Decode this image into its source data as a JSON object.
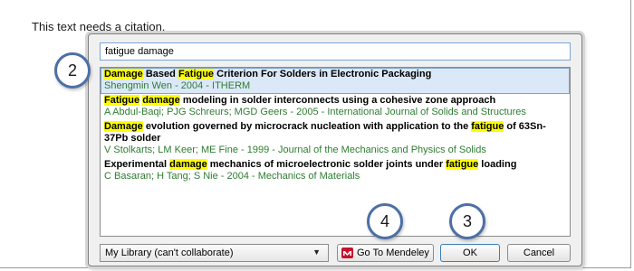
{
  "document": {
    "text": "This text needs a citation."
  },
  "dialog": {
    "search": {
      "value": "fatigue damage"
    },
    "results": [
      {
        "title_parts": [
          {
            "text": "Damage",
            "hl": true
          },
          {
            "text": " Based ",
            "hl": false
          },
          {
            "text": "Fatigue",
            "hl": true
          },
          {
            "text": " Criterion For Solders in Electronic Packaging",
            "hl": false
          }
        ],
        "meta": "Shengmin Wen - 2004 - ITHERM",
        "selected": true
      },
      {
        "title_parts": [
          {
            "text": "Fatigue",
            "hl": true
          },
          {
            "text": " ",
            "hl": false
          },
          {
            "text": "damage",
            "hl": true
          },
          {
            "text": " modeling in solder interconnects using a cohesive zone approach",
            "hl": false
          }
        ],
        "meta": "A Abdul-Baqi; PJG Schreurs; MGD Geers - 2005 - International Journal of Solids and Structures",
        "selected": false
      },
      {
        "title_parts": [
          {
            "text": "Damage",
            "hl": true
          },
          {
            "text": " evolution governed by microcrack nucleation with application to the ",
            "hl": false
          },
          {
            "text": "fatigue",
            "hl": true
          },
          {
            "text": " of 63Sn-37Pb solder",
            "hl": false
          }
        ],
        "meta": "V Stolkarts; LM Keer; ME Fine - 1999 - Journal of the Mechanics and Physics of Solids",
        "selected": false
      },
      {
        "title_parts": [
          {
            "text": "Experimental ",
            "hl": false
          },
          {
            "text": "damage",
            "hl": true
          },
          {
            "text": " mechanics of microelectronic solder joints under ",
            "hl": false
          },
          {
            "text": "fatigue",
            "hl": true
          },
          {
            "text": " loading",
            "hl": false
          }
        ],
        "meta": "C Basaran; H Tang; S Nie - 2004 - Mechanics of Materials",
        "selected": false
      }
    ],
    "library_select": {
      "value": "My Library (can't collaborate)"
    },
    "buttons": {
      "mendeley": "Go To Mendeley",
      "ok": "OK",
      "cancel": "Cancel"
    }
  },
  "callouts": {
    "c2": "2",
    "c3": "3",
    "c4": "4"
  },
  "colors": {
    "highlight": "#ffff00",
    "meta_green": "#2e7d32",
    "selection": "#dbe8f8",
    "callout_ring": "#4c6fa6"
  }
}
